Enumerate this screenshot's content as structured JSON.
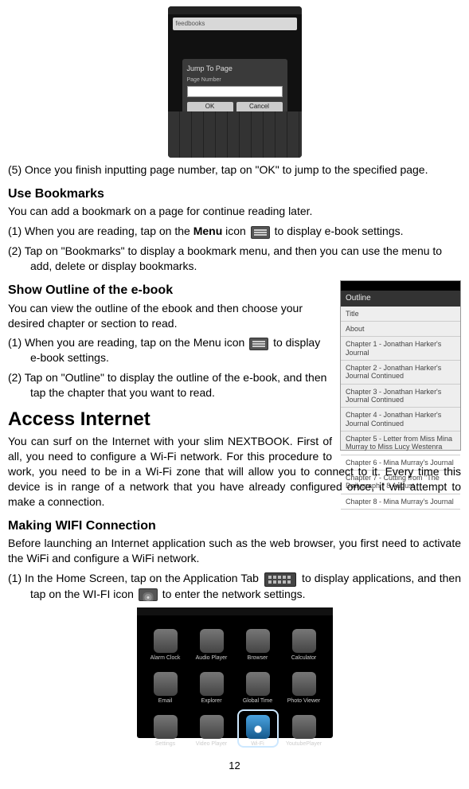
{
  "screenshot_top": {
    "dialog_title": "Jump To Page",
    "field_label": "Page Number",
    "ok_label": "OK",
    "cancel_label": "Cancel",
    "toolbar_label": "feedbooks"
  },
  "step5": "(5) Once you finish inputting page number, tap on \"OK\" to jump to the specified page.",
  "bookmarks": {
    "heading": "Use Bookmarks",
    "intro": "You can add a bookmark on a page for continue reading later.",
    "step1_a": "(1) When you are reading, tap on the ",
    "step1_menu": "Menu",
    "step1_b": " icon ",
    "step1_c": " to display e-book settings.",
    "step2": "(2) Tap on \"Bookmarks\" to display a bookmark menu, and then you can use the menu to add, delete or display bookmarks."
  },
  "outline": {
    "heading": "Show Outline of the e-book",
    "intro": "You can view the outline of the ebook and then choose your desired chapter or section to read.",
    "step1_a": "(1) When you are reading, tap on the Menu icon ",
    "step1_b": " to display e-book settings.",
    "step2": "(2) Tap on \"Outline\" to display the outline of the e-book, and then tap the chapter that you want to read.",
    "panel": {
      "header": "Outline",
      "items": [
        "Title",
        "About",
        "Chapter 1 - Jonathan Harker's Journal",
        "Chapter 2 - Jonathan Harker's Journal Continued",
        "Chapter 3 - Jonathan Harker's Journal Continued",
        "Chapter 4 - Jonathan Harker's Journal Continued",
        "Chapter 5 - Letter from Miss Mina Murray to Miss Lucy Westenra",
        "Chapter 6 - Mina Murray's Journal",
        "Chapter 7 - Cutting from \"The Dailygraph,\" 8 August",
        "Chapter 8 - Mina Murray's Journal"
      ]
    }
  },
  "internet": {
    "heading": "Access Internet",
    "para": "You can surf on the Internet with your slim NEXTBOOK. First of all, you need to configure a Wi-Fi network. For this procedure to work, you need to be in a Wi-Fi zone that will allow you to connect to it. Every time this device is in range of a network that you have already configured once, it will attempt to make a connection."
  },
  "wifi": {
    "heading": "Making WIFI Connection",
    "intro": "Before launching an Internet application such as the web browser, you first need to activate the WiFi and configure a WiFi network.",
    "step1_a": "(1) In the Home Screen, tap on the Application Tab ",
    "step1_b": " to display applications, and then tap on the WI-FI icon ",
    "step1_c": " to enter the network settings.",
    "apps": [
      "Alarm Clock",
      "Audio Player",
      "Browser",
      "Calculator",
      "Email",
      "Explorer",
      "Global Time",
      "Photo Viewer",
      "Settings",
      "Video Player",
      "Wi-Fi",
      "YoutubePlayer"
    ]
  },
  "page_number": "12"
}
